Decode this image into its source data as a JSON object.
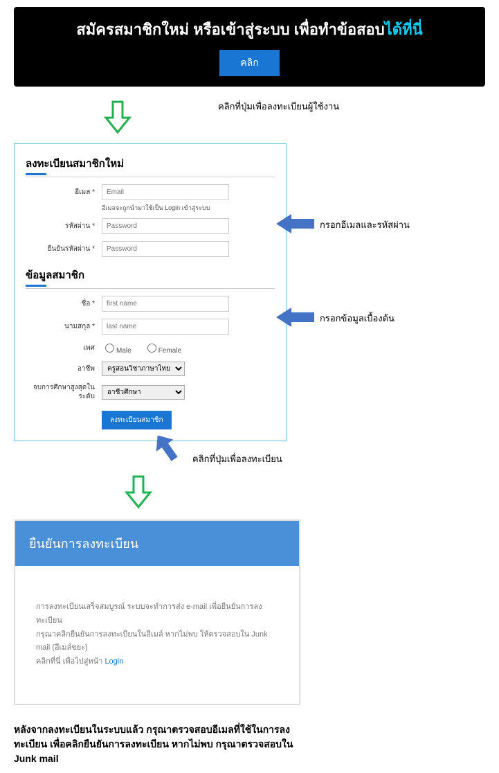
{
  "banner": {
    "title_main": "สมัครสมาชิกใหม่ หรือเข้าสู่ระบบ เพื่อทำข้อสอบ",
    "title_hl": "ได้ที่นี่",
    "click_label": "คลิก"
  },
  "annotations": {
    "arrow1": "คลิกที่ปุ่มเพื่อลงทะเบียนผู้ใช้งาน",
    "arrow2": "กรอกอีเมลและรหัสผ่าน",
    "arrow3": "กรอกข้อมูลเบื้องต้น",
    "arrow4": "คลิกที่ปุ่มเพื่อลงทะเบียน"
  },
  "register_form": {
    "section1_title": "ลงทะเบียนสมาชิกใหม่",
    "email_label": "อีเมล *",
    "email_placeholder": "Email",
    "email_hint": "อีเมลจะถูกนำมาใช้เป็น Login เข้าสู่ระบบ",
    "password_label": "รหัสผ่าน *",
    "password_placeholder": "Password",
    "confirm_label": "ยืนยันรหัสผ่าน *",
    "confirm_placeholder": "Password",
    "section2_title": "ข้อมูลสมาชิก",
    "firstname_label": "ชื่อ *",
    "firstname_placeholder": "first name",
    "lastname_label": "นามสกุล *",
    "lastname_placeholder": "last name",
    "gender_label": "เพศ",
    "gender_male": "Male",
    "gender_female": "Female",
    "occupation_label": "อาชีพ",
    "occupation_value": "ครูสอนวิชาภาษาไทย",
    "education_label": "จบการศึกษาสูงสุดในระดับ",
    "education_value": "อาชีวศึกษา",
    "submit_label": "ลงทะเบียนสมาชิก"
  },
  "confirm": {
    "header": "ยืนยันการลงทะเบียน",
    "line1": "การลงทะเบียนเสร็จสมบูรณ์ ระบบจะทำการส่ง e-mail เพื่อยืนยันการลงทะเบียน",
    "line2": "กรุณาคลิกยืนยันการลงทะเบียนในอีเมล์ หากไม่พบ ให้ตรวจสอบใน Junk mail (อีเมล์ขยะ)",
    "line3_pre": "คลิกที่นี่ เพื่อไปสู่หน้า ",
    "login_link": "Login"
  },
  "final_note": "หลังจากลงทะเบียนในระบบแล้ว กรุณาตรวจสอบอีเมลที่ใช้ในการลงทะเบียน เพื่อคลิกยืนยันการลงทะเบียน หากไม่พบ กรุณาตรวจสอบใน Junk mail"
}
